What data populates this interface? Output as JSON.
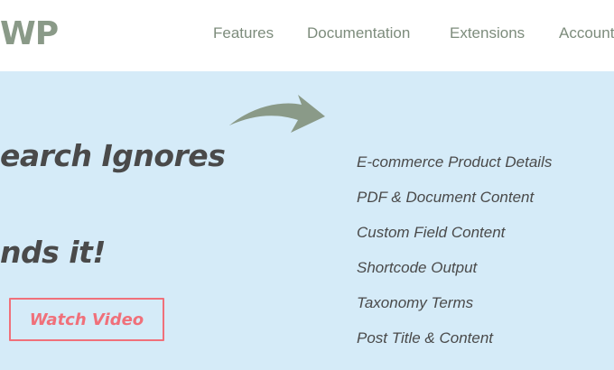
{
  "header": {
    "logo_text": "WP",
    "nav": [
      {
        "label": "Features"
      },
      {
        "label": "Documentation"
      },
      {
        "label": "Extensions"
      },
      {
        "label": "Account"
      }
    ]
  },
  "hero": {
    "headline_line1": "earch Ignores",
    "headline_line2": "nds it!",
    "cta_label": "Watch Video",
    "features": [
      "E-commerce Product Details",
      "PDF & Document Content",
      "Custom Field Content",
      "Shortcode Output",
      "Taxonomy Terms",
      "Post Title & Content"
    ]
  },
  "colors": {
    "brand": "#8a9a88",
    "hero_bg": "#d5ebf8",
    "cta": "#f0707a",
    "text": "#4a4a4a"
  },
  "icons": {
    "arrow": "curved-arrow-icon"
  }
}
